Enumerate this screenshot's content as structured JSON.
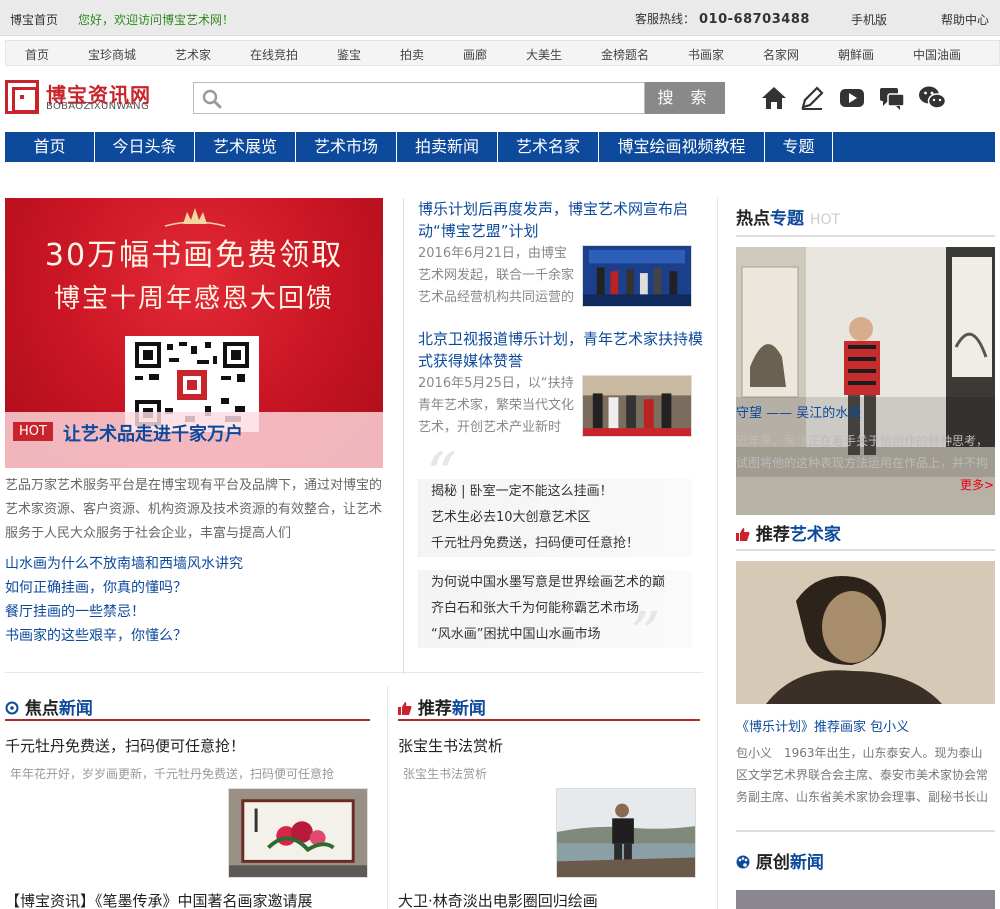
{
  "topbar": {
    "home": "博宝首页",
    "welcome": "您好，欢迎访问博宝艺术网！",
    "hotline_label": "客服热线：",
    "hotline_number": "010-68703488",
    "mobile": "手机版",
    "help": "帮助中心"
  },
  "subnav": [
    "首页",
    "宝珍商城",
    "艺术家",
    "在线竞拍",
    "鉴宝",
    "拍卖",
    "画廊",
    "大美生",
    "金榜题名",
    "书画家",
    "名家网",
    "朝鲜画",
    "中国油画"
  ],
  "logo": {
    "title": "博宝资讯网",
    "subtitle": "BOBAOZIXUNWANG"
  },
  "search": {
    "placeholder": "",
    "button": "搜 索"
  },
  "tools": [
    "home-icon",
    "pencil-icon",
    "video-icon",
    "chat-icon",
    "wechat-icon"
  ],
  "mainnav": [
    "首页",
    "今日头条",
    "艺术展览",
    "艺术市场",
    "拍卖新闻",
    "艺术名家",
    "博宝绘画视频教程",
    "专题"
  ],
  "banner": {
    "line1": "30万幅书画免费领取",
    "line2": "博宝十周年感恩大回馈",
    "hot_tag": "HOT",
    "caption": "让艺术品走进千家万户"
  },
  "intro": "艺品万家艺术服务平台是在博宝现有平台及品牌下，通过对博宝的艺术家资源、客户资源、机构资源及技术资源的有效整合，让艺术服务于人民大众服务于社会企业，丰富与提高人们",
  "left_links": [
    "山水画为什么不放南墙和西墙风水讲究",
    "如何正确挂画，你真的懂吗？",
    "餐厅挂画的一些禁忌！",
    "书画家的这些艰辛，你懂么？"
  ],
  "mid_news": [
    {
      "title": "博乐计划后再度发声，博宝艺术网宣布启动“博宝艺盟”计划",
      "desc": "2016年6月21日，由博宝艺术网发起，联合一千余家艺术品经营机构共同运营的"
    },
    {
      "title": "北京卫视报道博乐计划，青年艺术家扶持模式获得媒体赞誉",
      "desc": "2016年5月25日，以“扶持青年艺术家，繁荣当代文化艺术，开创艺术产业新时"
    }
  ],
  "mid_list_a": [
    "揭秘 | 卧室一定不能这么挂画！",
    "艺术生必去10大创意艺术区",
    "千元牡丹免费送，扫码便可任意抢！"
  ],
  "mid_list_b": [
    "为何说中国水墨写意是世界绘画艺术的巅",
    "齐白石和张大千为何能称霸艺术市场",
    "“风水画”困扰中国山水画市场"
  ],
  "right": {
    "hot_head_a": "热点",
    "hot_head_b": "专题",
    "hot_suffix": "HOT",
    "gallery_caption": "守望 —— 吴江的水墨",
    "gallery_desc": "近年来，吴江正在着手关于他创作的种种思考，试图将他的这种表现方法运用在作品上，并不拘泥于传统的技法，也没有任何程式的束缚",
    "more": "更多>",
    "artist_head_a": "推荐",
    "artist_head_b": "艺术家",
    "artist_name": "《博乐计划》推荐画家 包小义",
    "artist_desc": "包小义　1963年出生，山东泰安人。现为泰山区文学艺术界联合会主席、泰安市美术家协会常务副主席、山东省美术家协会理事、副秘书长山东",
    "orig_head_a": "原创",
    "orig_head_b": "新闻"
  },
  "focus": {
    "head_a": "焦点",
    "head_b": "新闻",
    "title": "千元牡丹免费送，扫码便可任意抢！",
    "sub": "年年花开好，岁岁画更新，千元牡丹免费送，扫码便可任意抢",
    "next": "【博宝资讯】《笔墨传承》中国著名画家邀请展"
  },
  "recommend": {
    "head_a": "推荐",
    "head_b": "新闻",
    "title": "张宝生书法赏析",
    "sub": "张宝生书法赏析",
    "next": "大卫·林奇淡出电影圈回归绘画"
  },
  "colors": {
    "brand_red": "#c9232b",
    "nav_blue": "#0d4a9c",
    "welcome_green": "#2e8b1e"
  }
}
